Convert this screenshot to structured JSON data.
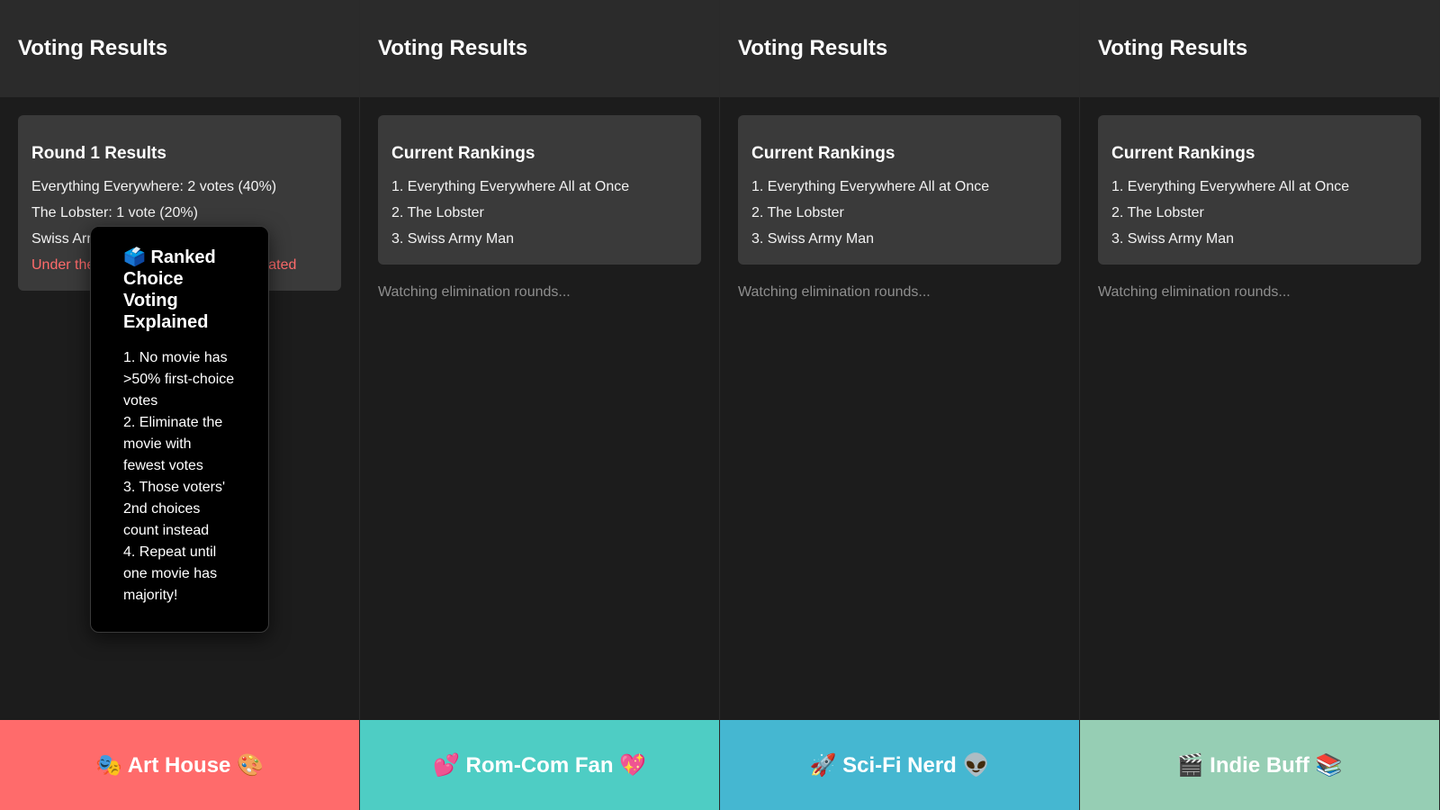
{
  "panels": [
    {
      "header": "Voting Results",
      "card": {
        "title": "Round 1 Results",
        "lines": [
          "Everything Everywhere: 2 votes (40%)",
          "The Lobster: 1 vote (20%)",
          "Swiss Army Man: 1 vote (20%)"
        ],
        "alert": "Under the Skin: 1 vote (20%) - Eliminated"
      },
      "footer": {
        "label": "🎭 Art House 🎨",
        "color": "#ff6b6b"
      }
    },
    {
      "header": "Voting Results",
      "card": {
        "title": "Current Rankings",
        "lines": [
          "1. Everything Everywhere All at Once",
          "2. The Lobster",
          "3. Swiss Army Man"
        ]
      },
      "status": "Watching elimination rounds...",
      "footer": {
        "label": "💕 Rom-Com Fan 💖",
        "color": "#4ecdc4"
      }
    },
    {
      "header": "Voting Results",
      "card": {
        "title": "Current Rankings",
        "lines": [
          "1. Everything Everywhere All at Once",
          "2. The Lobster",
          "3. Swiss Army Man"
        ]
      },
      "status": "Watching elimination rounds...",
      "footer": {
        "label": "🚀 Sci-Fi Nerd 👽",
        "color": "#45b7d1"
      }
    },
    {
      "header": "Voting Results",
      "card": {
        "title": "Current Rankings",
        "lines": [
          "1. Everything Everywhere All at Once",
          "2. The Lobster",
          "3. Swiss Army Man"
        ]
      },
      "status": "Watching elimination rounds...",
      "footer": {
        "label": "🎬 Indie Buff 📚",
        "color": "#96ceb4"
      }
    }
  ],
  "tooltip": {
    "title": "🗳️ Ranked Choice Voting Explained",
    "steps": [
      "1. No movie has >50% first-choice votes",
      "2. Eliminate the movie with fewest votes",
      "3. Those voters' 2nd choices count instead",
      "4. Repeat until one movie has majority!"
    ]
  },
  "colors": {
    "background": "#1c1c1c",
    "header": "#2b2b2b",
    "card": "#3a3a3a",
    "alert": "#ff6b6b",
    "muted": "#8e8e8e"
  }
}
